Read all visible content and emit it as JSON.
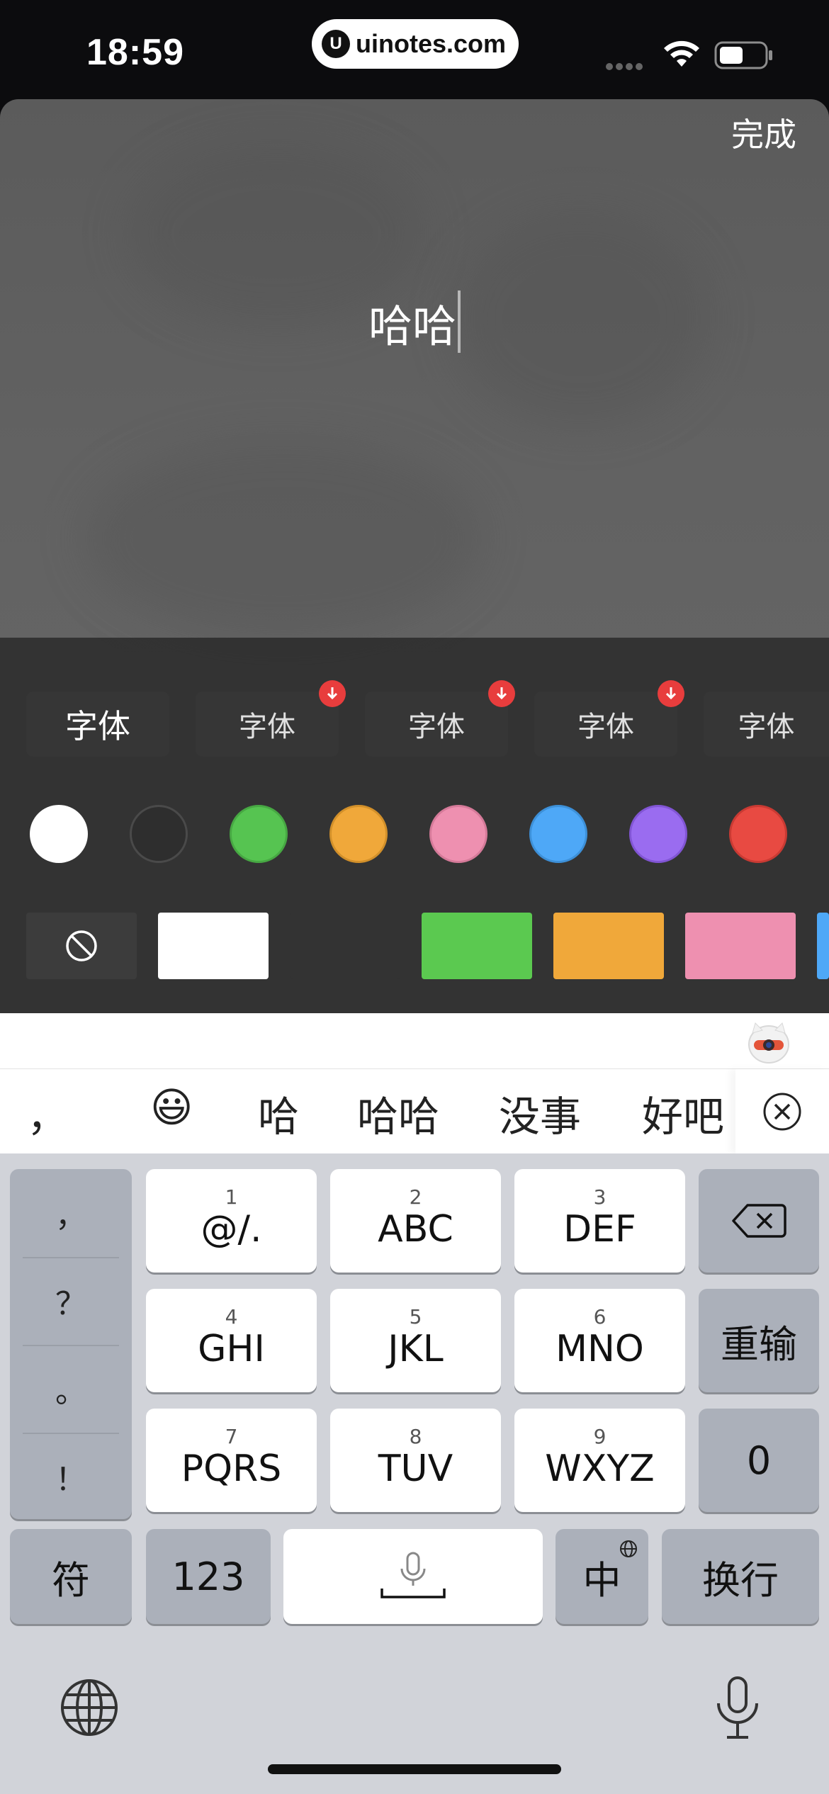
{
  "status": {
    "time": "18:59",
    "url": "uinotes.com"
  },
  "editor": {
    "done_label": "完成",
    "text_value": "哈哈"
  },
  "fonts": {
    "items": [
      {
        "label": "字体",
        "selected": true,
        "download": false
      },
      {
        "label": "字体",
        "selected": false,
        "download": true
      },
      {
        "label": "字体",
        "selected": false,
        "download": true
      },
      {
        "label": "字体",
        "selected": false,
        "download": true
      },
      {
        "label": "字体",
        "selected": false,
        "download": false
      }
    ]
  },
  "text_colors": [
    "#ffffff",
    "#2e2e2e",
    "#56c451",
    "#f0a83a",
    "#ee90b0",
    "#4ea8f7",
    "#9a6cf0",
    "#e84a42"
  ],
  "bg_colors": [
    "none",
    "#ffffff",
    "#333333",
    "#5bc950",
    "#f0a83a",
    "#ee90b0",
    "#4ea8f7"
  ],
  "candidates": {
    "items": [
      "，",
      "😃",
      "哈",
      "哈哈",
      "没事",
      "好吧"
    ]
  },
  "keyboard": {
    "punct": [
      "，",
      "？",
      "。",
      "！"
    ],
    "keys": [
      {
        "num": "1",
        "letters": "@/."
      },
      {
        "num": "2",
        "letters": "ABC"
      },
      {
        "num": "3",
        "letters": "DEF"
      },
      {
        "num": "4",
        "letters": "GHI"
      },
      {
        "num": "5",
        "letters": "JKL"
      },
      {
        "num": "6",
        "letters": "MNO"
      },
      {
        "num": "7",
        "letters": "PQRS"
      },
      {
        "num": "8",
        "letters": "TUV"
      },
      {
        "num": "9",
        "letters": "WXYZ"
      }
    ],
    "reenter_label": "重输",
    "zero_label": "0",
    "symbol_label": "符",
    "num_label": "123",
    "lang_label": "中",
    "return_label": "换行"
  },
  "icons": {
    "backspace": "backspace-icon",
    "microphone": "microphone-icon",
    "globe": "globe-icon",
    "close": "close-circle-icon",
    "none": "no-background-icon",
    "download": "download-badge-icon"
  }
}
